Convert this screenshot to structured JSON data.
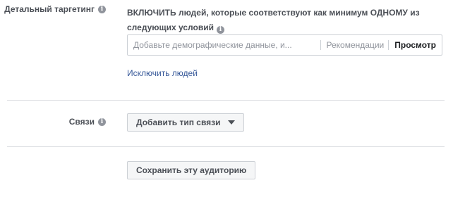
{
  "targeting": {
    "label": "Детальный таргетинг",
    "info_icon": "i",
    "description": "ВКЛЮЧИТЬ людей, которые соответствуют как минимум ОДНОМУ из следующих условий",
    "search_placeholder": "Добавьте демографические данные, и...",
    "suggestions_label": "Рекомендации",
    "browse_label": "Просмотр",
    "exclude_link": "Исключить людей"
  },
  "connections": {
    "label": "Связи",
    "info_icon": "i",
    "add_button": "Добавить тип связи"
  },
  "footer": {
    "save_button": "Сохранить эту аудиторию"
  },
  "colors": {
    "link": "#365899",
    "label_text": "#4b4f56",
    "placeholder": "#90949c",
    "border": "#ccd0d5",
    "divider": "#dddfe2",
    "button_bg": "#f5f6f7"
  },
  "icons": {
    "info": "info-icon",
    "dropdown": "caret-down-icon"
  }
}
